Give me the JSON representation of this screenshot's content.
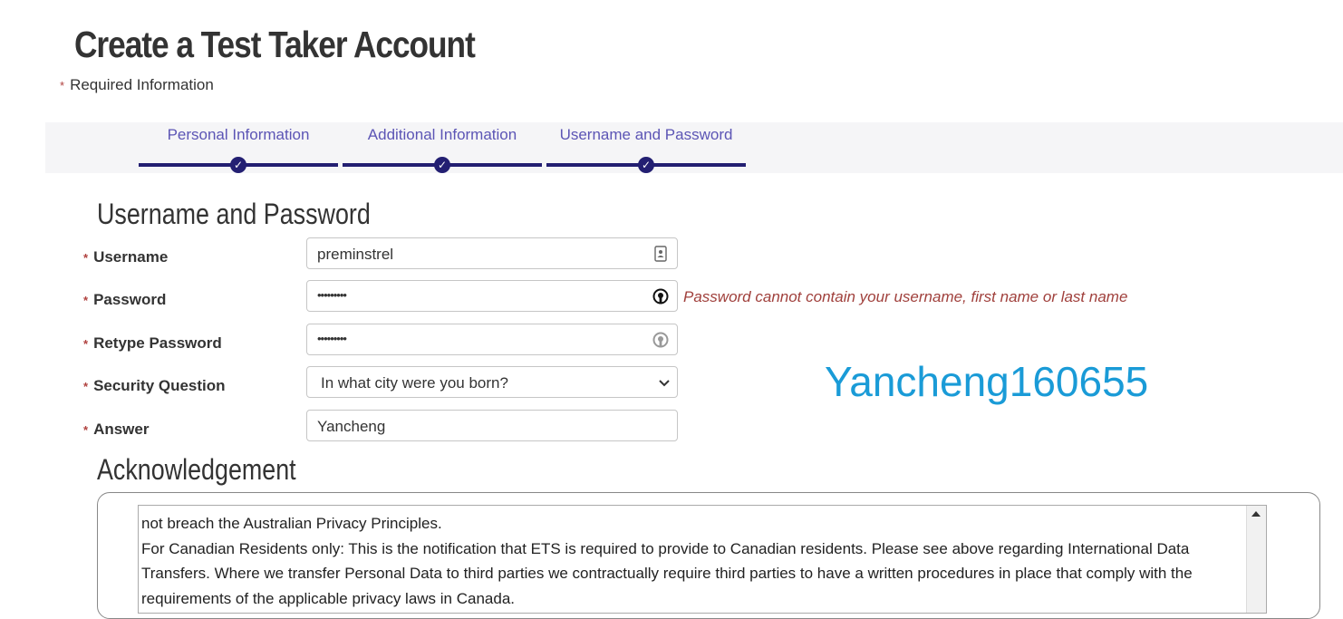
{
  "header": {
    "title": "Create a Test Taker Account",
    "required_star": "*",
    "required_note": "Required Information"
  },
  "steps": [
    {
      "label": "Personal Information",
      "completed": true
    },
    {
      "label": "Additional Information",
      "completed": true
    },
    {
      "label": "Username and Password",
      "completed": true
    }
  ],
  "form": {
    "section_title": "Username and Password",
    "username": {
      "label": "Username",
      "value": "preminstrel",
      "icon": "contact-card-icon"
    },
    "password": {
      "label": "Password",
      "masked": "•••••••••",
      "icon": "password-reveal-icon",
      "error": "Password cannot contain your username, first name or last name"
    },
    "retype_password": {
      "label": "Retype Password",
      "masked": "•••••••••",
      "icon": "password-reveal-icon"
    },
    "security_question": {
      "label": "Security Question",
      "selected": "In what city were you born?"
    },
    "answer": {
      "label": "Answer",
      "value": "Yancheng"
    }
  },
  "overlay_text": "Yancheng160655",
  "acknowledgement": {
    "title": "Acknowledgement",
    "paragraphs": [
      "not breach the Australian Privacy Principles.",
      "For Canadian Residents only:  This is the notification that ETS is required to provide to Canadian residents.  Please see above regarding International Data Transfers.  Where we transfer Personal Data to third parties we contractually require third parties to have a written procedures in place that comply with the requirements of the applicable privacy laws in Canada."
    ]
  },
  "colors": {
    "step_text": "#5c55b5",
    "step_bar": "#231f72",
    "error": "#a0403c",
    "required_star": "#b0413e",
    "overlay": "#1a9bd7"
  }
}
